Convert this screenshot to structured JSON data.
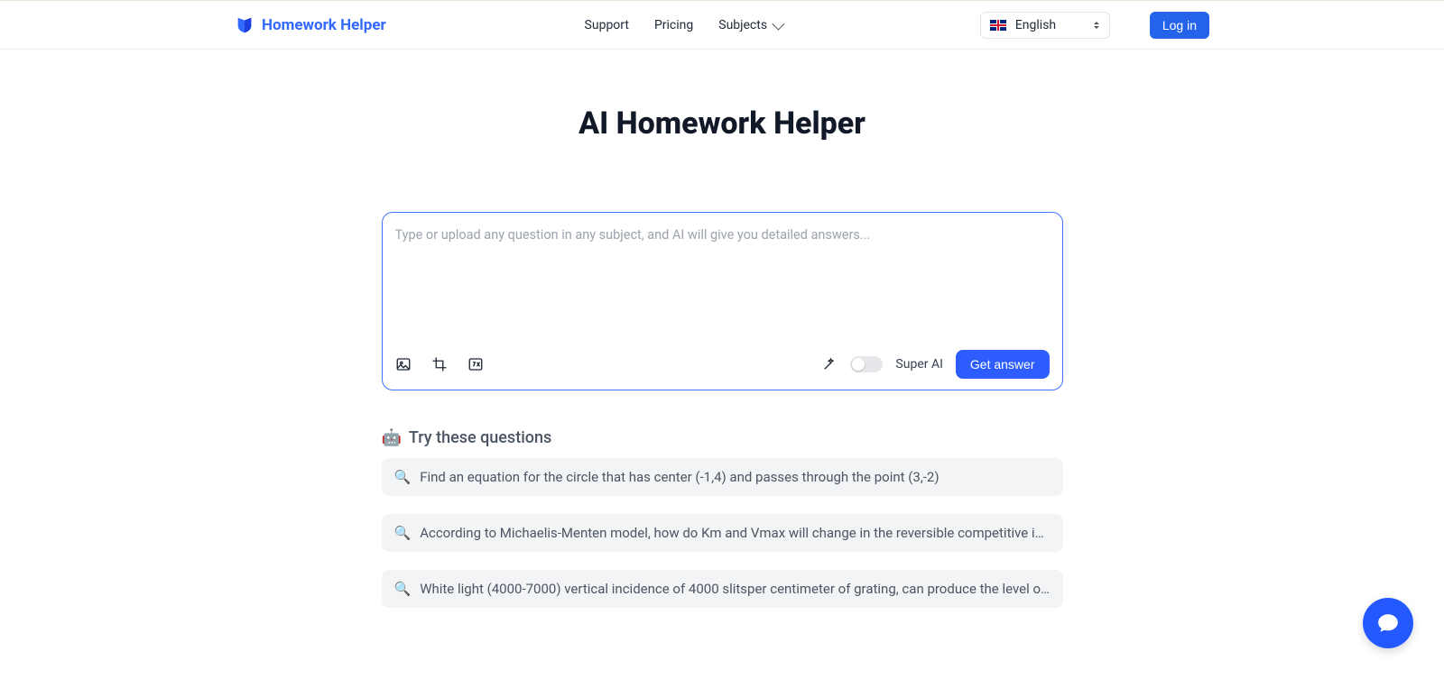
{
  "brand": {
    "name": "Homework Helper"
  },
  "nav": {
    "support": "Support",
    "pricing": "Pricing",
    "subjects": "Subjects",
    "language": "English",
    "login": "Log in"
  },
  "page": {
    "title": "AI Homework Helper"
  },
  "input": {
    "placeholder": "Type or upload any question in any subject, and AI will give you detailed answers...",
    "super_ai_label": "Super AI",
    "get_answer": "Get answer"
  },
  "suggestions": {
    "header_emoji": "🤖",
    "header": "Try these questions",
    "item_emoji": "🔍",
    "items": [
      "Find an equation for the circle that has center (-1,4) and passes through the point (3,-2)",
      "According to Michaelis-Menten model, how do Km and Vmax will change in the reversible competitive inhibi...",
      "White light (4000-7000) vertical incidence of 4000 slitsper centimeter of grating, can produce the level of t..."
    ]
  }
}
